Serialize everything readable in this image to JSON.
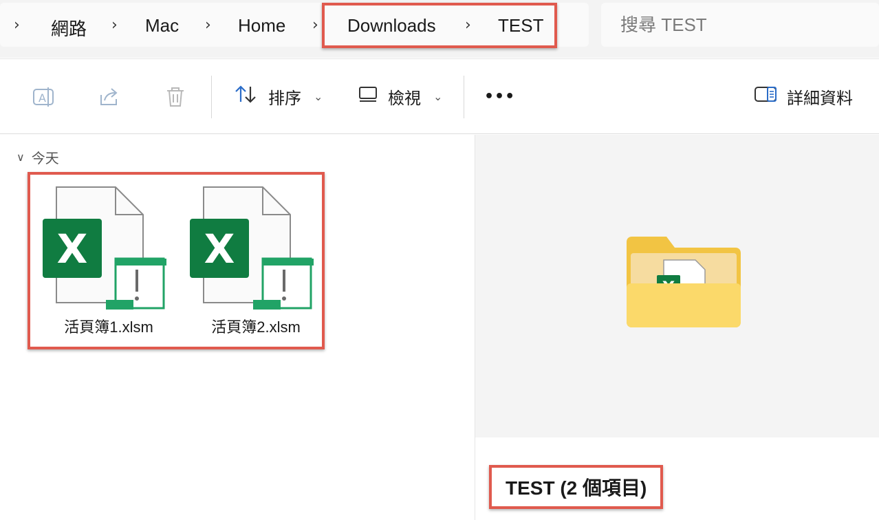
{
  "breadcrumb": {
    "items": [
      "網路",
      "Mac",
      "Home",
      "Downloads",
      "TEST"
    ]
  },
  "search": {
    "placeholder": "搜尋 TEST"
  },
  "toolbar": {
    "sort_label": "排序",
    "view_label": "檢視",
    "more_label": "•••",
    "details_label": "詳細資料"
  },
  "files": {
    "group_label": "今天",
    "items": [
      {
        "name": "活頁簿1.xlsm"
      },
      {
        "name": "活頁簿2.xlsm"
      }
    ]
  },
  "preview": {
    "title": "TEST (2 個項目)"
  },
  "colors": {
    "highlight": "#e05a4e",
    "excel_green": "#107c41",
    "macro_green": "#21a366",
    "folder_yellow": "#f2c443"
  }
}
